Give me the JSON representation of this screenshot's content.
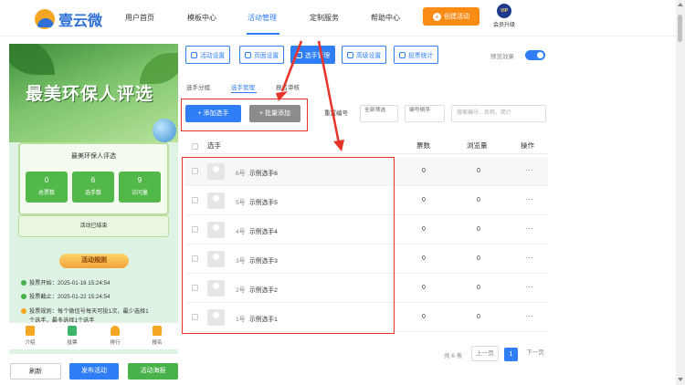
{
  "brand": {
    "name": "壹云微"
  },
  "nav": {
    "items": [
      "用户首页",
      "模板中心",
      "活动管理",
      "定制服务",
      "帮助中心"
    ],
    "create_label": "创建活动",
    "vip_badge": "VIP",
    "vip_label": "会员升级"
  },
  "phone": {
    "hero_title": "最美环保人评选",
    "card_title": "最美环保人评选",
    "stats": [
      {
        "value": "0",
        "label": "总票数"
      },
      {
        "value": "6",
        "label": "选手数"
      },
      {
        "value": "9",
        "label": "访问量"
      }
    ],
    "ended_text": "活动已结束",
    "rules_title": "活动规则",
    "rules": [
      "投票开始：2025-01-16 15:24:54",
      "投票截止：2025-01-22 15:24:54",
      "投票规则：每个微信号每天可投1次，最少选择1"
    ],
    "rule_overflow": "个选手，最多选择1个选手",
    "tabbar": [
      "介绍",
      "投票",
      "排行",
      "报名"
    ]
  },
  "bottom_buttons": {
    "refresh": "刷新",
    "publish": "发布活动",
    "preview": "活动海报"
  },
  "toolbar_tabs": [
    "活动设置",
    "页面设置",
    "选手管理",
    "高级设置",
    "投票统计"
  ],
  "preview_toggle_label": "预览效果",
  "inner_tabs": [
    "选手分组",
    "选手管理",
    "报名审核"
  ],
  "actions": {
    "add": "+ 添加选手",
    "batch_add": "+ 批量添加",
    "reset": "重置编号"
  },
  "filters": [
    {
      "top": "全部筛选",
      "bottom": ""
    },
    {
      "top": "编号倒序",
      "bottom": ""
    }
  ],
  "search": {
    "placeholder": "搜索编号、名称、简介"
  },
  "table": {
    "headers": {
      "player": "选手",
      "votes": "票数",
      "views": "浏览量",
      "ops": "操作"
    },
    "rows": [
      {
        "no": "6号",
        "name": "示例选手6",
        "votes": "0",
        "views": "0"
      },
      {
        "no": "5号",
        "name": "示例选手5",
        "votes": "0",
        "views": "0"
      },
      {
        "no": "4号",
        "name": "示例选手4",
        "votes": "0",
        "views": "0"
      },
      {
        "no": "3号",
        "name": "示例选手3",
        "votes": "0",
        "views": "0"
      },
      {
        "no": "2号",
        "name": "示例选手2",
        "votes": "0",
        "views": "0"
      },
      {
        "no": "1号",
        "name": "示例选手1",
        "votes": "0",
        "views": "0"
      }
    ],
    "more": "···"
  },
  "pager": {
    "total": "共 6 条",
    "prev": "上一页",
    "current": "1",
    "next": "下一页"
  }
}
